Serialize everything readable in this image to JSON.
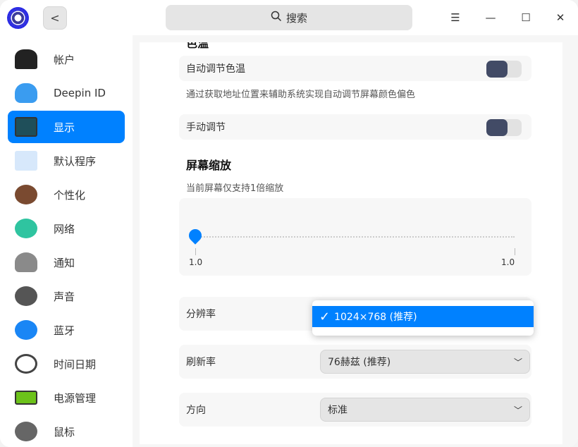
{
  "header": {
    "search_placeholder": "搜索",
    "back_label": "<",
    "menu_icon": "☰",
    "minimize_icon": "—",
    "maximize_icon": "☐",
    "close_icon": "✕"
  },
  "sidebar": {
    "items": [
      {
        "label": "帐户",
        "icon": "user-icon"
      },
      {
        "label": "Deepin ID",
        "icon": "cloud-icon"
      },
      {
        "label": "显示",
        "icon": "monitor-icon",
        "active": true
      },
      {
        "label": "默认程序",
        "icon": "default-apps-icon"
      },
      {
        "label": "个性化",
        "icon": "palette-icon"
      },
      {
        "label": "网络",
        "icon": "network-icon"
      },
      {
        "label": "通知",
        "icon": "bell-icon"
      },
      {
        "label": "声音",
        "icon": "speaker-icon"
      },
      {
        "label": "蓝牙",
        "icon": "bluetooth-icon"
      },
      {
        "label": "时间日期",
        "icon": "clock-icon"
      },
      {
        "label": "电源管理",
        "icon": "battery-icon"
      },
      {
        "label": "鼠标",
        "icon": "mouse-icon"
      }
    ]
  },
  "main": {
    "color_temp_title": "色温",
    "auto_color_temp": {
      "label": "自动调节色温",
      "on": false
    },
    "auto_color_desc": "通过获取地址位置来辅助系统实现自动调节屏幕颜色偏色",
    "manual_adjust": {
      "label": "手动调节",
      "on": false
    },
    "scale_title": "屏幕缩放",
    "scale_desc": "当前屏幕仅支持1倍缩放",
    "scale_slider": {
      "value": 1.0,
      "min_label": "1.0",
      "max_label": "1.0"
    },
    "resolution": {
      "label": "分辨率",
      "selected": "1024×768 (推荐)",
      "check": "✓"
    },
    "refresh_rate": {
      "label": "刷新率",
      "value": "76赫兹 (推荐)"
    },
    "orientation": {
      "label": "方向",
      "value": "标准"
    }
  }
}
